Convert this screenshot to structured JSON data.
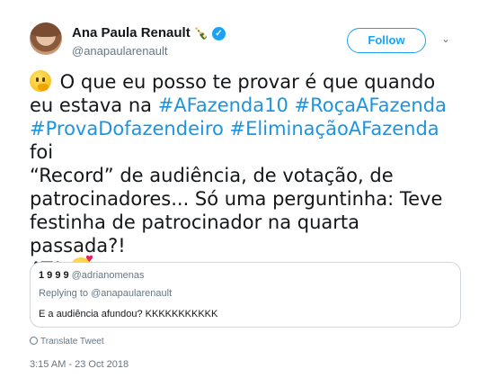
{
  "author": {
    "name": "Ana Paula Renault",
    "name_emoji": "🍾",
    "handle": "@anapaularenault",
    "verified": true
  },
  "follow_label": "Follow",
  "tweet": {
    "lines": [
      [
        {
          "t": "emoji",
          "icon": "thinking-face-icon"
        },
        {
          "t": "text",
          "v": " O que eu posso te provar é que quando"
        }
      ],
      [
        {
          "t": "text",
          "v": "eu estava na "
        },
        {
          "t": "hashtag",
          "v": "#AFazenda10"
        },
        {
          "t": "text",
          "v": " "
        },
        {
          "t": "hashtag",
          "v": "#RoçaAFazenda"
        }
      ],
      [
        {
          "t": "hashtag",
          "v": "#ProvaDofazendeiro"
        },
        {
          "t": "text",
          "v": " "
        },
        {
          "t": "hashtag",
          "v": "#EliminaçãoAFazenda"
        },
        {
          "t": "text",
          "v": " foi"
        }
      ],
      [
        {
          "t": "text",
          "v": "“Record” de audiência, de votação, de"
        }
      ],
      [
        {
          "t": "text",
          "v": "patrocinadores... Só uma perguntinha: Teve"
        }
      ],
      [
        {
          "t": "text",
          "v": "festinha de patrocinador na quarta passada?!"
        }
      ],
      [
        {
          "t": "text",
          "v": "ATA "
        },
        {
          "t": "emoji",
          "icon": "kissing-face-icon"
        }
      ]
    ]
  },
  "quoted": {
    "name": "1 9 9 9",
    "handle": "@adrianomenas",
    "replying_to": "Replying to @anapaularenault",
    "text": "E a audiência afundou? KKKKKKKKKKK"
  },
  "translate_label": "Translate Tweet",
  "timestamp": "3:15 AM - 23 Oct 2018",
  "colors": {
    "link": "#1b95e0",
    "accent": "#1da1f2",
    "muted": "#657786",
    "text": "#14171a"
  }
}
